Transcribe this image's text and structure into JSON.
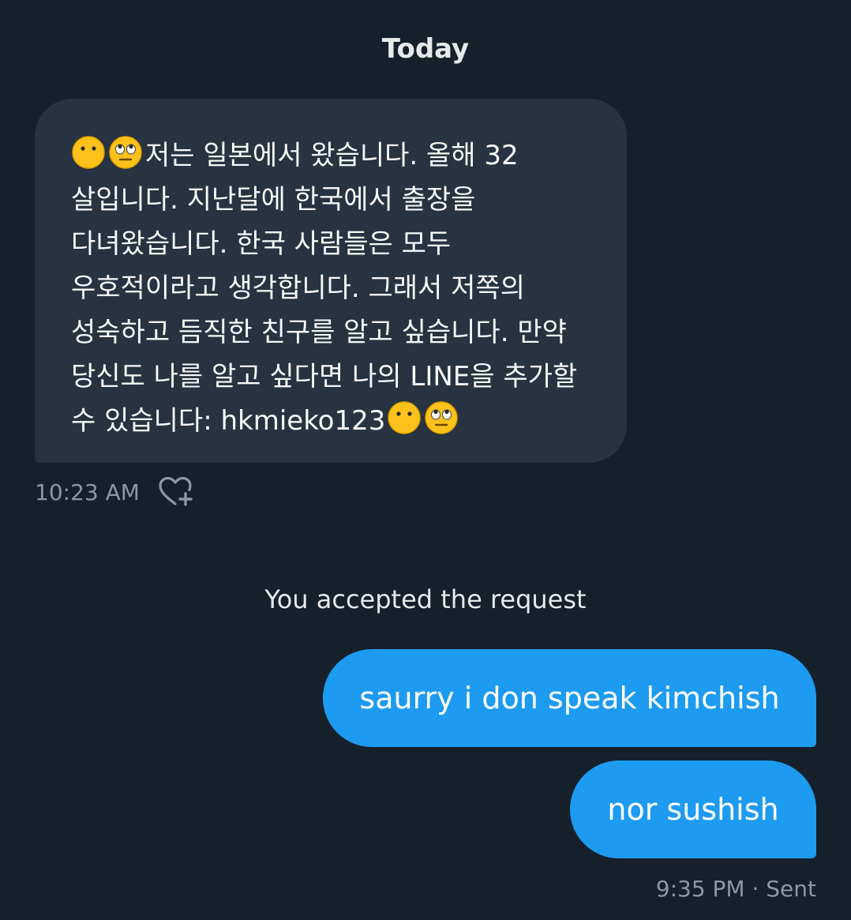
{
  "conversation": {
    "day_label": "Today",
    "incoming": {
      "leading_emojis": [
        "face-with-rolling-eyes-alt-icon",
        "face-with-rolling-eyes-icon"
      ],
      "text": "저는 일본에서 왔습니다. 올해 32 살입니다. 지난달에 한국에서 출장을 다녀왔습니다. 한국 사람들은 모두 우호적이라고 생각합니다. 그래서 저쪽의 성숙하고 듬직한 친구를 알고 싶습니다. 만약 당신도 나를 알고 싶다면 나의 LINE을 추가할 수 있습니다: hkmieko123",
      "trailing_emojis": [
        "face-with-rolling-eyes-alt-icon",
        "face-with-rolling-eyes-icon"
      ],
      "time": "10:23 AM",
      "react_icon": "heart-plus-icon"
    },
    "system_message": "You accepted the request",
    "outgoing": [
      {
        "text": "saurry i don speak kimchish"
      },
      {
        "text": "nor sushish"
      }
    ],
    "outgoing_meta": "9:35 PM · Sent"
  },
  "colors": {
    "background": "#15202b",
    "incoming_bubble": "#273340",
    "outgoing_bubble": "#1d9bf0",
    "meta_text": "#8b98a5"
  }
}
